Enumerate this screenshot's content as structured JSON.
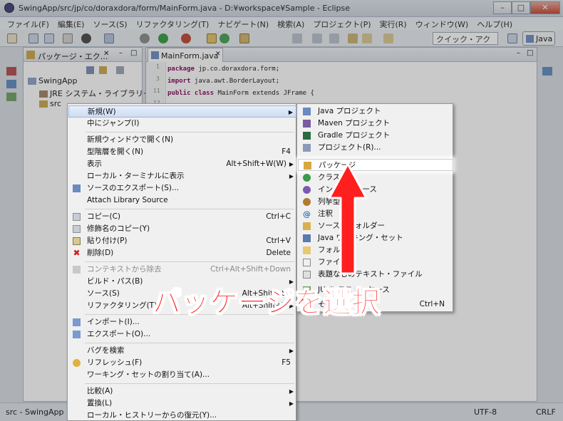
{
  "window": {
    "title": "SwingApp/src/jp/co/doraxdora/form/MainForm.java - D:¥workspace¥Sample - Eclipse"
  },
  "menubar": [
    "ファイル(F)",
    "編集(E)",
    "ソース(S)",
    "リファクタリング(T)",
    "ナビゲート(N)",
    "検索(A)",
    "プロジェクト(P)",
    "実行(R)",
    "ウィンドウ(W)",
    "ヘルプ(H)"
  ],
  "toolbar": {
    "quick_access": "クイック・アクセス",
    "perspective": "Java"
  },
  "package_explorer": {
    "tab": "パッケージ・エク...",
    "tree": [
      "SwingApp",
      "JRE システム・ライブラリー",
      "src"
    ]
  },
  "editor": {
    "tab": "MainForm.java",
    "lines": [
      {
        "num": "1",
        "kw": "package",
        "rest": " jp.co.doraxdora.form;"
      },
      {
        "num": "3",
        "kw": "import",
        "rest": " java.awt.BorderLayout;"
      },
      {
        "num": "11",
        "kw": "public class",
        "rest": " MainForm extends JFrame {"
      },
      {
        "num": "12",
        "kw": "",
        "rest": ""
      }
    ]
  },
  "context_menu": [
    {
      "label": "新規(W)",
      "shortcut": "",
      "submenu": true,
      "highlight": true
    },
    {
      "label": "中にジャンプ(I)",
      "shortcut": ""
    },
    {
      "label": "新規ウィンドウで開く(N)",
      "shortcut": ""
    },
    {
      "label": "型階層を開く(N)",
      "shortcut": "F4"
    },
    {
      "label": "表示",
      "shortcut": "Alt+Shift+W(W)",
      "submenu": true
    },
    {
      "label": "ローカル・ターミナルに表示",
      "shortcut": "",
      "submenu": true
    },
    {
      "label": "ソースのエクスポート(S)...",
      "shortcut": ""
    },
    {
      "label": "Attach Library Source",
      "shortcut": ""
    },
    {
      "label": "コピー(C)",
      "shortcut": "Ctrl+C"
    },
    {
      "label": "修飾名のコピー(Y)",
      "shortcut": ""
    },
    {
      "label": "貼り付け(P)",
      "shortcut": "Ctrl+V"
    },
    {
      "label": "削除(D)",
      "shortcut": "Delete"
    },
    {
      "label": "コンテキストから除去",
      "shortcut": "Ctrl+Alt+Shift+Down",
      "disabled": true
    },
    {
      "label": "ビルド・パス(B)",
      "shortcut": "",
      "submenu": true
    },
    {
      "label": "ソース(S)",
      "shortcut": "Alt+Shift+S",
      "submenu": true
    },
    {
      "label": "リファクタリング(T)",
      "shortcut": "Alt+Shift+T",
      "submenu": true
    },
    {
      "label": "インポート(I)...",
      "shortcut": ""
    },
    {
      "label": "エクスポート(O)...",
      "shortcut": ""
    },
    {
      "label": "バグを検索",
      "shortcut": "",
      "submenu": true
    },
    {
      "label": "リフレッシュ(F)",
      "shortcut": "F5"
    },
    {
      "label": "ワーキング・セットの割り当て(A)...",
      "shortcut": ""
    },
    {
      "label": "比較(A)",
      "shortcut": "",
      "submenu": true
    },
    {
      "label": "置換(L)",
      "shortcut": "",
      "submenu": true
    },
    {
      "label": "ローカル・ヒストリーからの復元(Y)...",
      "shortcut": ""
    }
  ],
  "submenu": [
    {
      "label": "Java プロジェクト",
      "shortcut": ""
    },
    {
      "label": "Maven プロジェクト",
      "shortcut": ""
    },
    {
      "label": "Gradle プロジェクト",
      "shortcut": ""
    },
    {
      "label": "プロジェクト(R)...",
      "shortcut": ""
    },
    {
      "label": "パッケージ",
      "shortcut": "",
      "selected": true
    },
    {
      "label": "クラス",
      "shortcut": ""
    },
    {
      "label": "インターフェース",
      "shortcut": ""
    },
    {
      "label": "列挙型",
      "shortcut": ""
    },
    {
      "label": "注釈",
      "shortcut": ""
    },
    {
      "label": "ソース・フォルダー",
      "shortcut": ""
    },
    {
      "label": "Java ワーキング・セット",
      "shortcut": ""
    },
    {
      "label": "フォルダー",
      "shortcut": ""
    },
    {
      "label": "ファイル",
      "shortcut": ""
    },
    {
      "label": "表題なしのテキスト・ファイル",
      "shortcut": ""
    },
    {
      "label": "JUnit テスト・ケース",
      "shortcut": ""
    },
    {
      "label": "その他(O)...",
      "shortcut": "Ctrl+N"
    }
  ],
  "annotation": {
    "text": "パッケージを選択",
    "color": "#ff1f1f"
  },
  "status": {
    "left": "src - SwingApp",
    "encoding": "UTF-8",
    "eol": "CRLF"
  }
}
